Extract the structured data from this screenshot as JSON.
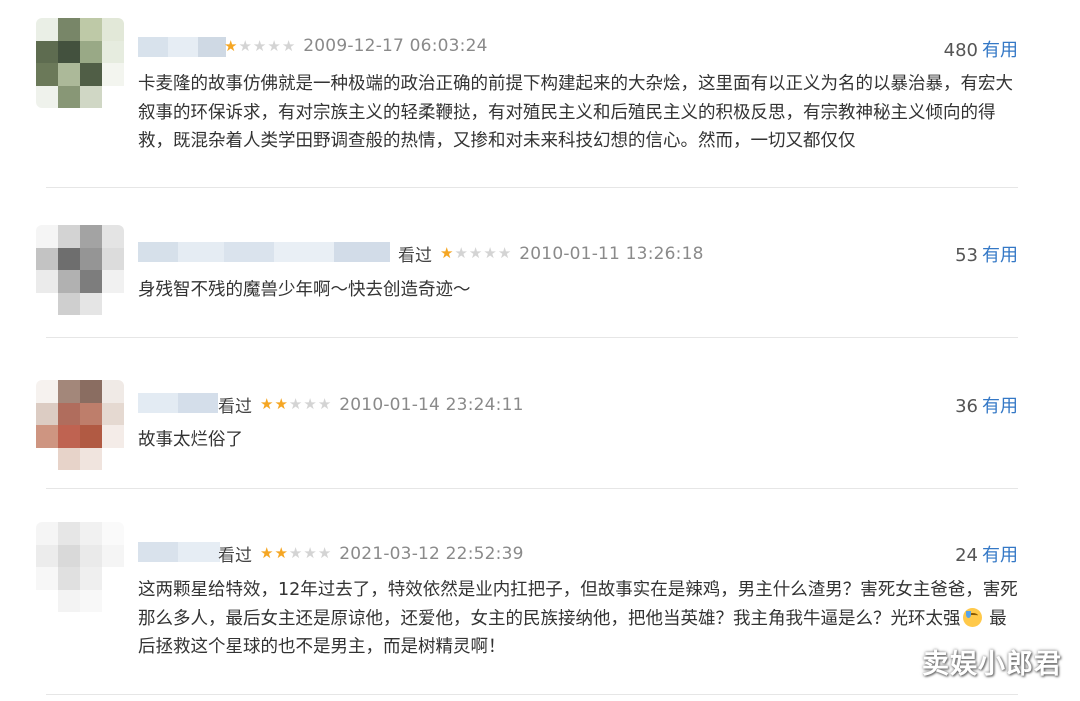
{
  "reviews": [
    {
      "status": "",
      "rating": 1,
      "date": "2009-12-17 06:03:24",
      "votes": "480",
      "useful_label": "有用",
      "text": "卡麦隆的故事仿佛就是一种极端的政治正确的前提下构建起来的大杂烩，这里面有以正义为名的以暴治暴，有宏大叙事的环保诉求，有对宗族主义的轻柔鞭挞，有对殖民主义和后殖民主义的积极反思，有宗教神秘主义倾向的得救，既混杂着人类学田野调查般的热情，又掺和对未来科技幻想的信心。然而，一切又都仅仅"
    },
    {
      "status": "看过",
      "rating": 1,
      "date": "2010-01-11 13:26:18",
      "votes": "53",
      "useful_label": "有用",
      "text": "身残智不残的魔兽少年啊～快去创造奇迹～"
    },
    {
      "status": "看过",
      "rating": 2,
      "date": "2010-01-14 23:24:11",
      "votes": "36",
      "useful_label": "有用",
      "text": "故事太烂俗了"
    },
    {
      "status": "看过",
      "rating": 2,
      "date": "2021-03-12 22:52:39",
      "votes": "24",
      "useful_label": "有用",
      "text_before_emoji": "这两颗星给特效，12年过去了，特效依然是业内扛把子，但故事实在是辣鸡，男主什么渣男？害死女主爸爸，害死那么多人，最后女主还是原谅他，还爱他，女主的民族接纳他，把他当英雄？我主角我牛逼是么？光环太强",
      "text_after_emoji": " 最后拯救这个星球的也不是男主，而是树精灵啊！"
    }
  ],
  "watermark": "卖娱小郎君",
  "colors": {
    "star_on": "#f5a623",
    "star_off": "#d4d4d4",
    "useful": "#3478c6"
  }
}
